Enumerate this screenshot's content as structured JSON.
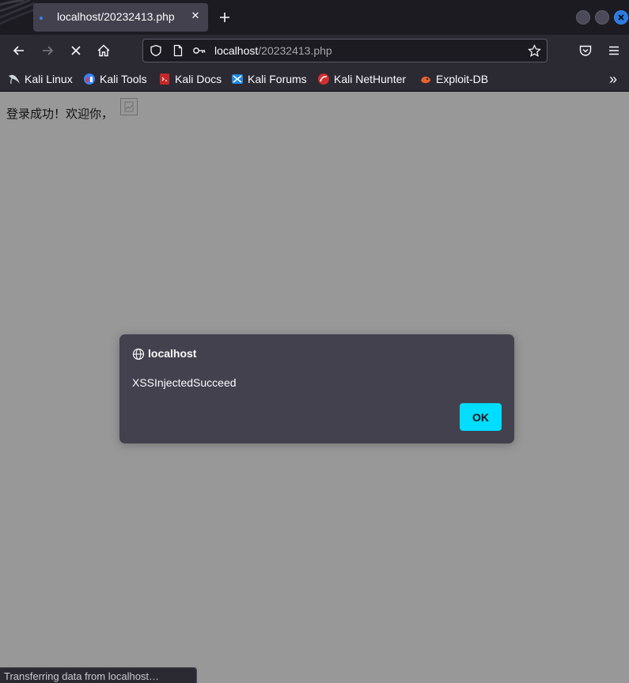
{
  "browser": {
    "tab": {
      "title": "localhost/20232413.php",
      "close_glyph": "✕"
    },
    "url": {
      "host": "localhost",
      "path": "/20232413.php"
    },
    "bookmarks": [
      {
        "label": "Kali Linux",
        "icon": "kali-dragon-icon"
      },
      {
        "label": "Kali Tools",
        "icon": "kali-tools-icon"
      },
      {
        "label": "Kali Docs",
        "icon": "kali-docs-icon"
      },
      {
        "label": "Kali Forums",
        "icon": "kali-forums-icon"
      },
      {
        "label": "Kali NetHunter",
        "icon": "kali-nethunter-icon"
      },
      {
        "label": "Exploit-DB",
        "icon": "exploit-db-icon"
      }
    ],
    "overflow_glyph": "»",
    "status": "Transferring data from localhost…"
  },
  "page": {
    "text": "登录成功！欢迎你，"
  },
  "dialog": {
    "origin": "localhost",
    "message": "XSSInjectedSucceed",
    "ok_label": "OK"
  },
  "colors": {
    "accent": "#00ddff",
    "toolbar": "#2b2a33",
    "tabstrip": "#1c1b22",
    "page_overlay": "#989899",
    "dialog": "#42414d"
  }
}
